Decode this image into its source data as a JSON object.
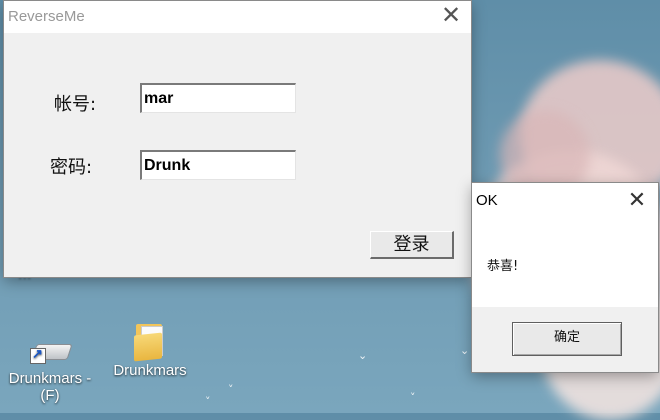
{
  "desktop": {
    "partial_label": "...",
    "icons": [
      {
        "label": "Drunkmars - (F)",
        "icon": "drive-shortcut-icon"
      },
      {
        "label": "Drunkmars",
        "icon": "folder-icon"
      }
    ]
  },
  "main_window": {
    "title": "ReverseMe",
    "close_glyph": "✕",
    "account_label": "帐号:",
    "account_value": "mar",
    "password_label": "密码:",
    "password_value": "Drunk",
    "login_label": "登录"
  },
  "ok_dialog": {
    "title": "OK",
    "close_glyph": "✕",
    "message": "恭喜!",
    "confirm_label": "确定"
  }
}
